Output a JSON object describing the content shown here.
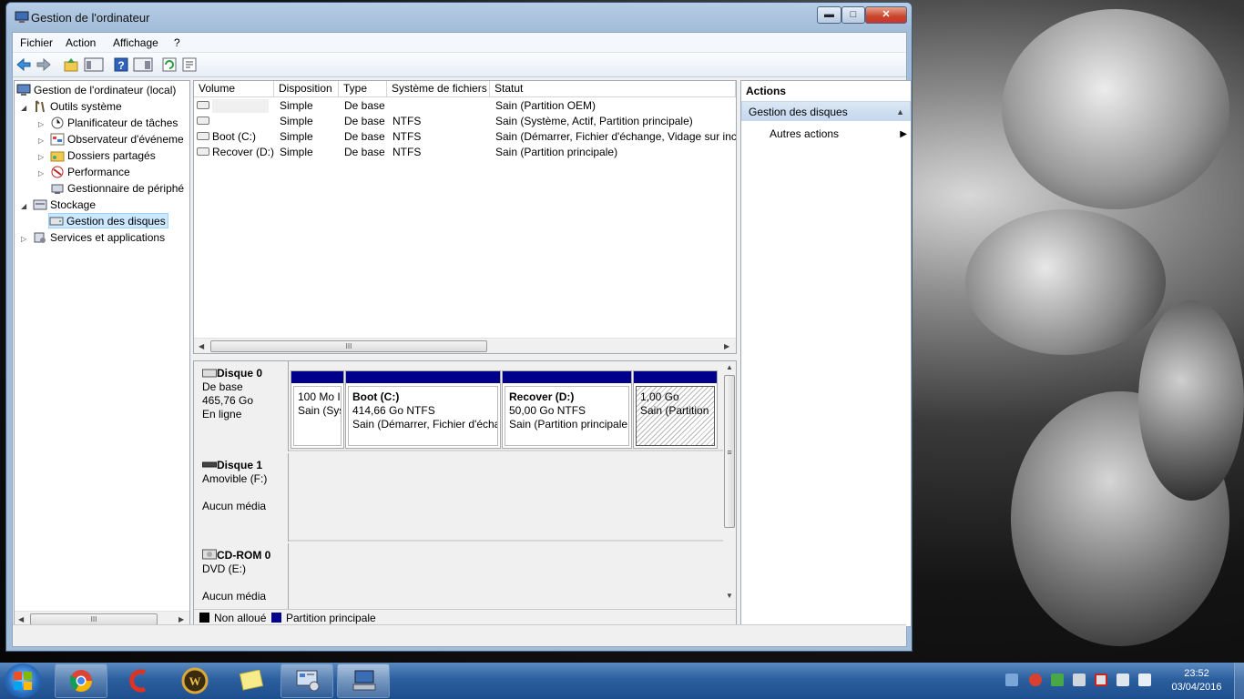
{
  "window": {
    "title": "Gestion de l'ordinateur",
    "controls": {
      "minimize": "▬",
      "maximize": "□",
      "close": "✕"
    }
  },
  "menu": {
    "items": [
      "Fichier",
      "Action",
      "Affichage",
      "?"
    ]
  },
  "toolbar": {
    "icons": [
      "back-icon",
      "forward-icon",
      "up-folder-icon",
      "show-tree-icon",
      "help-icon",
      "show-action-pane-icon",
      "refresh-icon",
      "export-list-icon"
    ]
  },
  "tree": {
    "root": "Gestion de l'ordinateur (local)",
    "system_tools": "Outils système",
    "task_scheduler": "Planificateur de tâches",
    "event_viewer": "Observateur d'événeme",
    "shared_folders": "Dossiers partagés",
    "performance": "Performance",
    "device_manager": "Gestionnaire de périphé",
    "storage": "Stockage",
    "disk_management": "Gestion des disques",
    "services_apps": "Services et applications",
    "scroll_thumb": "III"
  },
  "volumes": {
    "headers": [
      "Volume",
      "Disposition",
      "Type",
      "Système de fichiers",
      "Statut"
    ],
    "rows": [
      {
        "volume": "",
        "layout": "Simple",
        "type": "De base",
        "fs": "",
        "status": "Sain (Partition OEM)"
      },
      {
        "volume": "",
        "layout": "Simple",
        "type": "De base",
        "fs": "NTFS",
        "status": "Sain (Système, Actif, Partition principale)"
      },
      {
        "volume": "Boot (C:)",
        "layout": "Simple",
        "type": "De base",
        "fs": "NTFS",
        "status": "Sain (Démarrer, Fichier d'échange, Vidage sur incic"
      },
      {
        "volume": "Recover (D:)",
        "layout": "Simple",
        "type": "De base",
        "fs": "NTFS",
        "status": "Sain (Partition principale)"
      }
    ],
    "scroll_thumb": "III"
  },
  "disks": {
    "disk0": {
      "name": "Disque 0",
      "type": "De base",
      "size": "465,76 Go",
      "state": "En ligne",
      "partitions": [
        {
          "title": "",
          "size": "100 Mo I",
          "status": "Sain (Sys"
        },
        {
          "title": "Boot  (C:)",
          "size": "414,66 Go NTFS",
          "status": "Sain (Démarrer, Fichier d'écha"
        },
        {
          "title": "Recover  (D:)",
          "size": "50,00 Go NTFS",
          "status": "Sain (Partition principale"
        },
        {
          "title": "",
          "size": "1,00 Go",
          "status": "Sain (Partition"
        }
      ]
    },
    "disk1": {
      "name": "Disque 1",
      "type": "Amovible (F:)",
      "media": "Aucun média"
    },
    "cdrom0": {
      "name": "CD-ROM 0",
      "type": "DVD (E:)",
      "media": "Aucun média"
    },
    "scroll_thumb": "≡"
  },
  "legend": {
    "unallocated": "Non alloué",
    "primary": "Partition principale",
    "unallocated_color": "#000000",
    "primary_color": "#00008b"
  },
  "actions": {
    "header": "Actions",
    "section": "Gestion des disques",
    "more": "Autres actions"
  },
  "taskbar": {
    "apps": [
      "windows-start-icon",
      "chrome-icon",
      "ccleaner-icon",
      "world-of-warcraft-icon",
      "sticky-notes-icon",
      "control-panel-icon",
      "computer-management-icon"
    ],
    "time": "23:52",
    "date": "03/04/2016"
  },
  "colors": {
    "primary_partition": "#00008b",
    "selection": "#cce8ff",
    "taskbar": "#2c5f9e"
  }
}
